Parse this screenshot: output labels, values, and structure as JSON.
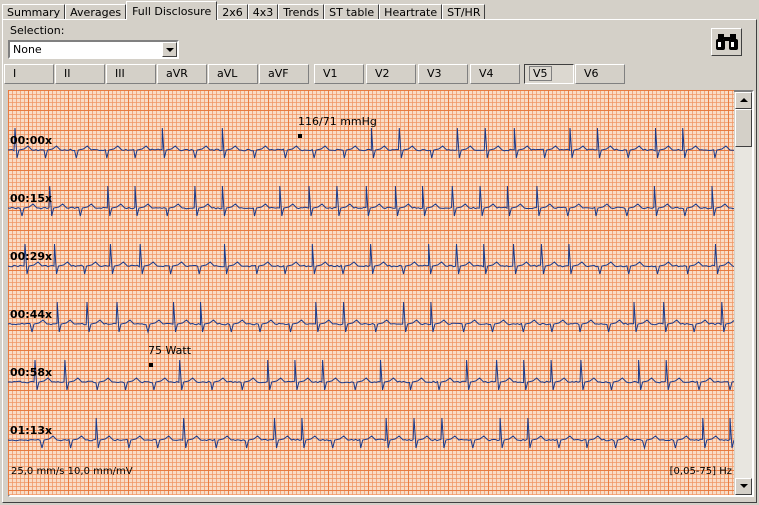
{
  "tabs": [
    {
      "label": "Summary"
    },
    {
      "label": "Averages"
    },
    {
      "label": "Full Disclosure",
      "active": true
    },
    {
      "label": "2x6"
    },
    {
      "label": "4x3"
    },
    {
      "label": "Trends"
    },
    {
      "label": "ST table"
    },
    {
      "label": "Heartrate"
    },
    {
      "label": "ST/HR"
    }
  ],
  "selection": {
    "label": "Selection:",
    "value": "None"
  },
  "find_button": {
    "icon": "binoculars-icon"
  },
  "leads": [
    {
      "label": "I"
    },
    {
      "label": "II"
    },
    {
      "label": "III"
    },
    {
      "label": "aVR"
    },
    {
      "label": "aVL"
    },
    {
      "label": "aVF"
    },
    {
      "label": "V1"
    },
    {
      "label": "V2"
    },
    {
      "label": "V3"
    },
    {
      "label": "V4"
    },
    {
      "label": "V5",
      "active": true
    },
    {
      "label": "V6"
    }
  ],
  "ecg": {
    "rows": [
      {
        "time": "00:00x"
      },
      {
        "time": "00:15x"
      },
      {
        "time": "00:29x"
      },
      {
        "time": "00:44x"
      },
      {
        "time": "00:58x"
      },
      {
        "time": "01:13x"
      }
    ],
    "annotations": [
      {
        "text": "116/71 mmHg",
        "row": 0
      },
      {
        "text": "75 Watt",
        "row": 4
      }
    ],
    "footer_left": "25,0 mm/s 10,0 mm/mV",
    "footer_right": "[0,05-75] Hz",
    "trace_color": "#1a3a8a",
    "grid_major_color": "#e8783c",
    "grid_minor_color": "#f0966a",
    "background_color": "#f9dcc6"
  }
}
